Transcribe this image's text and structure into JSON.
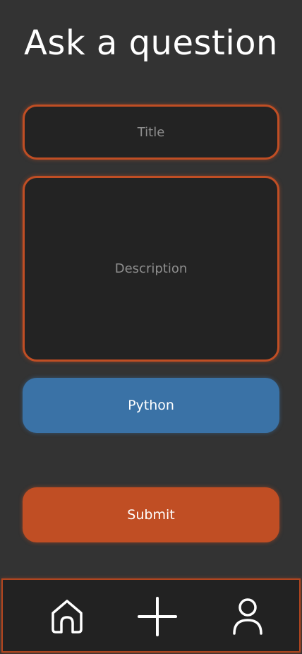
{
  "header": {
    "title": "Ask a question"
  },
  "form": {
    "title_placeholder": "Title",
    "description_placeholder": "Description",
    "tag_label": "Python",
    "submit_label": "Submit"
  },
  "nav": {
    "items": [
      {
        "icon": "home-icon"
      },
      {
        "icon": "plus-icon"
      },
      {
        "icon": "user-icon"
      }
    ]
  },
  "colors": {
    "background": "#333333",
    "field_background": "#232323",
    "accent_orange": "#c04e24",
    "tag_blue": "#3a72a6",
    "placeholder_text": "#8e8e8e",
    "text": "#ffffff"
  }
}
